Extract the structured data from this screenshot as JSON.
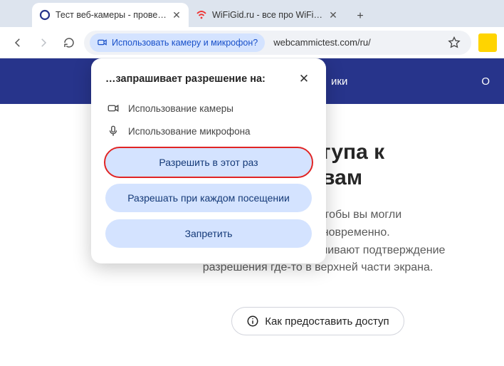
{
  "tabs": {
    "t1": {
      "title": "Тест веб-камеры - проверка к"
    },
    "t2": {
      "title": "WiFiGid.ru - все про WiFi и бес"
    }
  },
  "toolbar": {
    "chip": "Использовать камеру и микрофон?",
    "url": "webcammictest.com/ru/"
  },
  "hero": {
    "nav1": "ики",
    "right": "О"
  },
  "popup": {
    "title": "…запрашивает разрешение на:",
    "perm_camera": "Использование камеры",
    "perm_mic": "Использование микрофона",
    "allow_once": "Разрешить в этот раз",
    "allow_always": "Разрешать при каждом посещении",
    "deny": "Запретить"
  },
  "content": {
    "title_l1": "ие доступа к",
    "title_l2": "ойствам",
    "sub_l1": "м устройствам, чтобы вы могли",
    "sub_l2": "пособность одновременно.",
    "sub_l3": "Браузеры обычно запрашивают подтверждение",
    "sub_l4": "разрешения где-то в верхней части экрана.",
    "how_btn": "Как предоставить доступ"
  }
}
